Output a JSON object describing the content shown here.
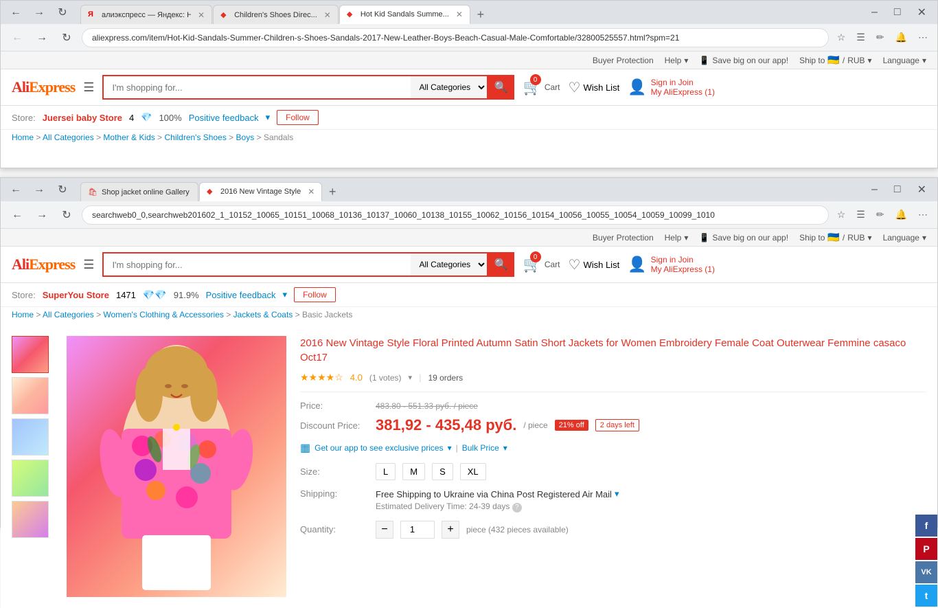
{
  "browser1": {
    "tabs": [
      {
        "id": "t1",
        "favicon": "ya",
        "label": "Я алиэкспресс — Яндекс: На...",
        "active": false,
        "closable": true
      },
      {
        "id": "t2",
        "favicon": "ali",
        "label": "Children&#39;s Shoes Direc...",
        "active": false,
        "closable": true
      },
      {
        "id": "t3",
        "favicon": "ali",
        "label": "Hot Kid Sandals Summe...",
        "active": true,
        "closable": true
      }
    ],
    "url": "aliexpress.com/item/Hot-Kid-Sandals-Summer-Children-s-Shoes-Sandals-2017-New-Leather-Boys-Beach-Casual-Male-Comfortable/32800525557.html?spm=21",
    "topbar": {
      "buyer_protection": "Buyer Protection",
      "help": "Help",
      "app_text": "Save big on our app!",
      "ship_to": "Ship to",
      "currency": "RUB",
      "language": "Language"
    },
    "header": {
      "logo": "AliExpress",
      "search_placeholder": "I'm shopping for...",
      "all_categories": "All Categories",
      "cart_count": "0",
      "cart_label": "Cart",
      "wish_list": "Wish List",
      "sign_in": "Sign in",
      "join": "Join",
      "my_aliexpress": "My AliExpress (1)"
    },
    "store_bar": {
      "store_label": "Store:",
      "store_name": "Juersei baby Store",
      "rating": "4",
      "feedback_pct": "100%",
      "positive_feedback": "Positive feedback",
      "follow_btn": "Follow"
    },
    "breadcrumb": {
      "items": [
        "Home",
        "All Categories",
        "Mother & Kids",
        "Children's Shoes",
        "Boys",
        "Sandals"
      ]
    }
  },
  "browser2": {
    "tabs": [
      {
        "id": "t1",
        "favicon": "shop",
        "label": "Shop jacket online Gallery -",
        "active": false,
        "closable": false
      },
      {
        "id": "t2",
        "favicon": "ali",
        "label": "2016 New Vintage Style",
        "active": true,
        "closable": true
      }
    ],
    "url": "searchweb0_0,searchweb201602_1_10152_10065_10151_10068_10136_10137_10060_10138_10155_10062_10156_10154_10056_10055_10054_10059_10099_1010",
    "topbar": {
      "buyer_protection": "Buyer Protection",
      "help": "Help",
      "app_text": "Save big on our app!",
      "ship_to": "Ship to",
      "currency": "RUB",
      "language": "Language"
    },
    "header": {
      "logo": "AliExpress",
      "search_placeholder": "I'm shopping for...",
      "all_categories": "All Categories",
      "cart_count": "0",
      "cart_label": "Cart",
      "wish_list": "Wish List",
      "sign_in": "Sign in",
      "join": "Join",
      "my_aliexpress": "My AliExpress (1)"
    },
    "store_bar": {
      "store_label": "Store:",
      "store_name": "SuperYou Store",
      "rating": "1471",
      "feedback_pct": "91.9%",
      "positive_feedback": "Positive feedback",
      "follow_btn": "Follow",
      "feedback_word": "feedback"
    },
    "breadcrumb": {
      "items": [
        "Home",
        "All Categories",
        "Women's Clothing & Accessories",
        "Jackets & Coats",
        "Basic Jackets"
      ]
    },
    "product": {
      "title": "2016 New Vintage Style Floral Printed Autumn Satin Short Jackets for Women Embroidery Female Coat Outerwear Femmine casaco Oct17",
      "rating": "4.0",
      "votes": "1 votes",
      "orders": "19 orders",
      "original_price": "483.80 - 551.33 руб. / piece",
      "price_label": "Price:",
      "discount_label": "Discount Price:",
      "discount_price": "381,92 - 435,48 руб.",
      "per_piece": "/ piece",
      "discount_pct": "21% off",
      "time_left": "2 days left",
      "app_line": "Get our app to see exclusive prices",
      "bulk_price": "Bulk Price",
      "size_label": "Size:",
      "sizes": [
        "L",
        "M",
        "S",
        "XL"
      ],
      "shipping_label": "Shipping:",
      "shipping_text": "Free Shipping to Ukraine via China Post Registered Air Mail",
      "delivery_text": "Estimated Delivery Time: 24-39 days",
      "quantity_label": "Quantity:",
      "quantity_value": "1",
      "pieces_available": "piece (432 pieces available)"
    },
    "social": {
      "facebook": "f",
      "pinterest": "P",
      "vk": "VK",
      "twitter": "t"
    }
  }
}
